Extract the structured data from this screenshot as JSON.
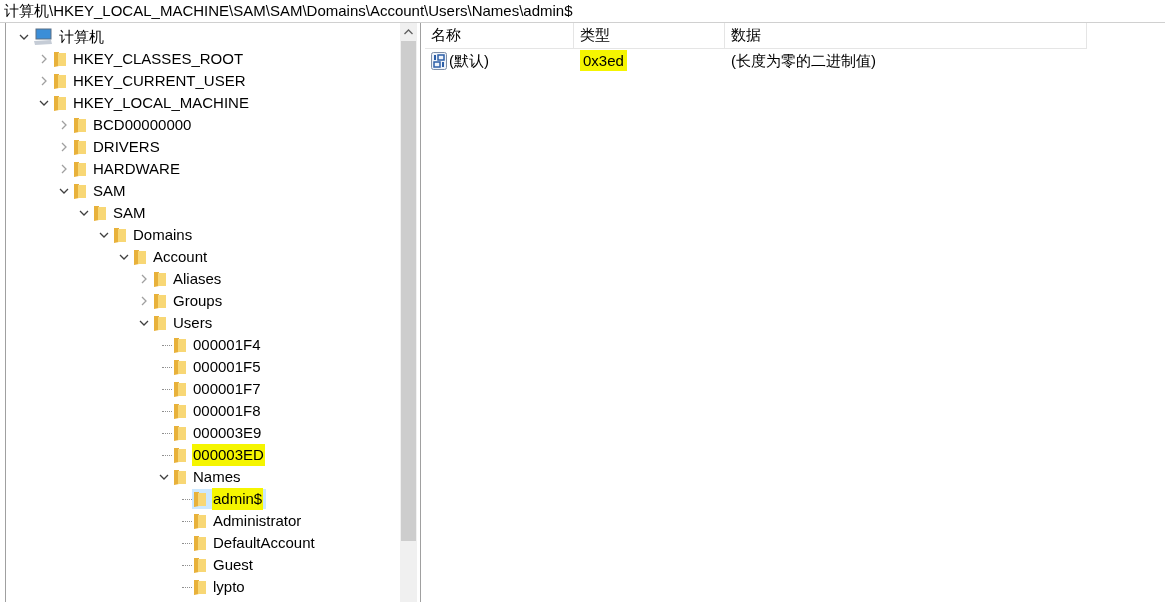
{
  "address_bar": "计算机\\HKEY_LOCAL_MACHINE\\SAM\\SAM\\Domains\\Account\\Users\\Names\\admin$",
  "tree": [
    {
      "label": "计算机",
      "expanded": true,
      "selected": false,
      "highlighted": false,
      "children": [
        {
          "label": "HKEY_CLASSES_ROOT",
          "expanded": false,
          "selected": false,
          "highlighted": false
        },
        {
          "label": "HKEY_CURRENT_USER",
          "expanded": false,
          "selected": false,
          "highlighted": false
        },
        {
          "label": "HKEY_LOCAL_MACHINE",
          "expanded": true,
          "selected": false,
          "highlighted": false,
          "children": [
            {
              "label": "BCD00000000",
              "expanded": false,
              "selected": false,
              "highlighted": false
            },
            {
              "label": "DRIVERS",
              "expanded": false,
              "selected": false,
              "highlighted": false
            },
            {
              "label": "HARDWARE",
              "expanded": false,
              "selected": false,
              "highlighted": false
            },
            {
              "label": "SAM",
              "expanded": true,
              "selected": false,
              "highlighted": false,
              "children": [
                {
                  "label": "SAM",
                  "expanded": true,
                  "selected": false,
                  "highlighted": false,
                  "children": [
                    {
                      "label": "Domains",
                      "expanded": true,
                      "selected": false,
                      "highlighted": false,
                      "children": [
                        {
                          "label": "Account",
                          "expanded": true,
                          "selected": false,
                          "highlighted": false,
                          "children": [
                            {
                              "label": "Aliases",
                              "expanded": false,
                              "selected": false,
                              "highlighted": false
                            },
                            {
                              "label": "Groups",
                              "expanded": false,
                              "selected": false,
                              "highlighted": false
                            },
                            {
                              "label": "Users",
                              "expanded": true,
                              "selected": false,
                              "highlighted": false,
                              "children": [
                                {
                                  "label": "000001F4",
                                  "selected": false,
                                  "highlighted": false
                                },
                                {
                                  "label": "000001F5",
                                  "selected": false,
                                  "highlighted": false
                                },
                                {
                                  "label": "000001F7",
                                  "selected": false,
                                  "highlighted": false
                                },
                                {
                                  "label": "000001F8",
                                  "selected": false,
                                  "highlighted": false
                                },
                                {
                                  "label": "000003E9",
                                  "selected": false,
                                  "highlighted": false
                                },
                                {
                                  "label": "000003ED",
                                  "selected": false,
                                  "highlighted": true
                                },
                                {
                                  "label": "Names",
                                  "expanded": true,
                                  "selected": false,
                                  "highlighted": false,
                                  "children": [
                                    {
                                      "label": "admin$",
                                      "selected": true,
                                      "highlighted": true
                                    },
                                    {
                                      "label": "Administrator",
                                      "selected": false,
                                      "highlighted": false
                                    },
                                    {
                                      "label": "DefaultAccount",
                                      "selected": false,
                                      "highlighted": false
                                    },
                                    {
                                      "label": "Guest",
                                      "selected": false,
                                      "highlighted": false
                                    },
                                    {
                                      "label": "lypto",
                                      "selected": false,
                                      "highlighted": false
                                    }
                                  ]
                                }
                              ]
                            }
                          ]
                        }
                      ]
                    }
                  ]
                }
              ]
            }
          ]
        }
      ]
    }
  ],
  "values_table": {
    "columns": [
      "名称",
      "类型",
      "数据"
    ],
    "rows": [
      {
        "name": "(默认)",
        "type": "0x3ed",
        "data": "(长度为零的二进制值)",
        "type_highlighted": true
      }
    ]
  }
}
